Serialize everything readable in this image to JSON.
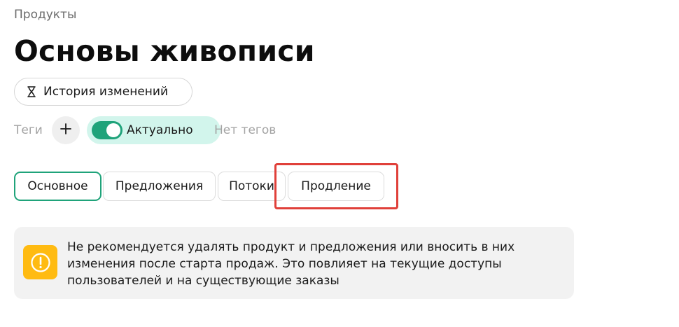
{
  "breadcrumb": "Продукты",
  "title": "Основы живописи",
  "history_button": {
    "label": "История изменений",
    "icon": "hourglass-icon"
  },
  "tags": {
    "label": "Теги",
    "add_icon": "plus-icon",
    "status_toggle": {
      "label": "Актуально",
      "on": true,
      "color": "#1fa37a",
      "background": "#d2f5ec"
    },
    "empty_text": "Нет тегов"
  },
  "tabs": [
    {
      "label": "Основное",
      "active": true
    },
    {
      "label": "Предложения",
      "active": false
    },
    {
      "label": "Потоки",
      "active": false
    },
    {
      "label": "Продление",
      "active": false,
      "highlighted": true
    }
  ],
  "highlight_color": "#e0403a",
  "alert": {
    "icon": "warning-icon",
    "icon_color": "#ffbb12",
    "text": "Не рекомендуется удалять продукт и предложения или вносить в них изменения после старта продаж. Это повлияет на текущие доступы пользователей и на существующие заказы"
  }
}
